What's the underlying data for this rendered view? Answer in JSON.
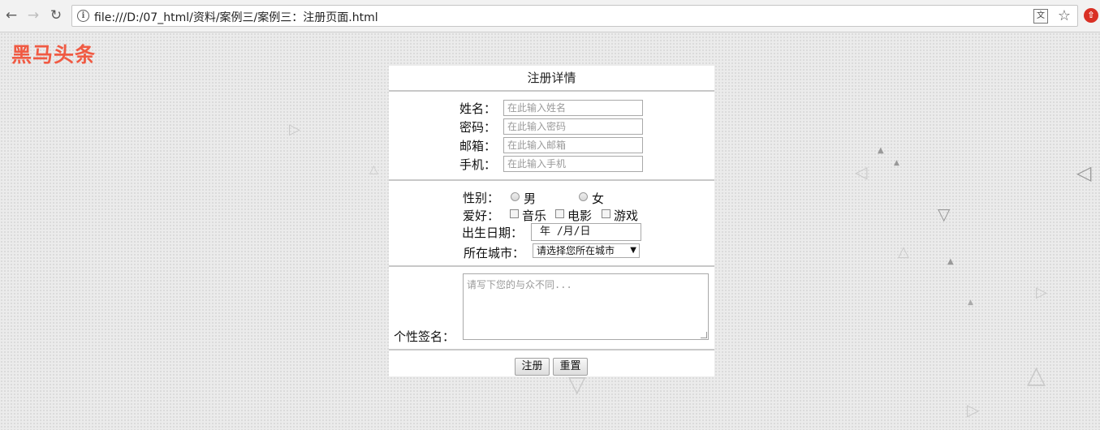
{
  "browser": {
    "url": "file:///D:/07_html/资料/案例三/案例三：注册页面.html",
    "icons": [
      "back-icon",
      "forward-icon",
      "reload-icon",
      "info-icon",
      "translate-icon",
      "star-icon",
      "extension-icon"
    ]
  },
  "logo": "黑马头条",
  "form": {
    "title": "注册详情",
    "fields": [
      {
        "label": "姓名：",
        "placeholder": "在此输入姓名"
      },
      {
        "label": "密码：",
        "placeholder": "在此输入密码"
      },
      {
        "label": "邮箱：",
        "placeholder": "在此输入邮箱"
      },
      {
        "label": "手机：",
        "placeholder": "在此输入手机"
      }
    ],
    "gender": {
      "label": "性别：",
      "options": [
        "男",
        "女"
      ]
    },
    "hobbies": {
      "label": "爱好：",
      "options": [
        "音乐",
        "电影",
        "游戏"
      ]
    },
    "birthday": {
      "label": "出生日期：",
      "value": "年 /月/日"
    },
    "city": {
      "label": "所在城市：",
      "selected": "请选择您所在城市"
    },
    "signature": {
      "label": "个性签名：",
      "placeholder": "请写下您的与众不同..."
    },
    "buttons": {
      "submit": "注册",
      "reset": "重置"
    }
  },
  "colors": {
    "logo": "#f05a43",
    "page_background": "#ebebeb",
    "form_background": "#ffffff"
  }
}
